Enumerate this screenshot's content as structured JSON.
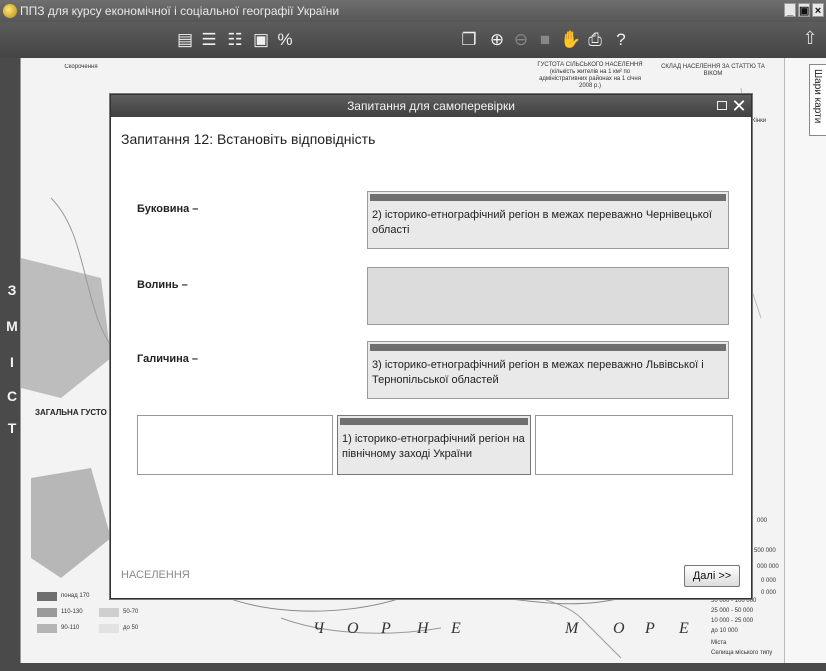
{
  "window": {
    "title": "ППЗ для курсу економічної і соціальної географії України",
    "controls": [
      "_",
      "▣",
      "×"
    ]
  },
  "side_letters": [
    "З",
    "М",
    "І",
    "С",
    "Т"
  ],
  "map": {
    "legend_title": "Скорочення",
    "left_heading": "ЗАГАЛЬНА ГУСТО",
    "right_heading": "ГУСТОТА СІЛЬСЬКОГО НАСЕЛЕННЯ",
    "right_subheading": "(кількість жителів на 1 км² по адміністративних районах на 1 січня 2008 р.)",
    "far_right_heading": "СКЛАД НАСЕЛЕННЯ ЗА СТАТТЮ ТА ВІКОМ",
    "bottom_letters": [
      "Ч",
      "О",
      "Р",
      "Н",
      "Е",
      "М",
      "О",
      "Р",
      "Е"
    ],
    "legend_items": [
      "понад 170",
      "110-130",
      "90-110",
      "50-70",
      "до 50"
    ],
    "right_numbers": [
      "000",
      "2 500 000",
      "000 000",
      "0 000",
      "0 000",
      "50 000 - 100 000",
      "25 000 - 50 000",
      "10 000 - 25 000",
      "до 10 000",
      "Міста",
      "Селища міського типу"
    ],
    "female_label": "Жінки"
  },
  "right_panel": {
    "layers_tab": "Шари карти"
  },
  "dialog": {
    "title": "Запитання для самоперевірки",
    "question": "Запитання 12: Встановіть відповідність",
    "rows": [
      {
        "label": "Буковина –",
        "answer": "2) історико-етнографічний регіон в межах переважно Чернівецької області"
      },
      {
        "label": "Волинь –",
        "answer": ""
      },
      {
        "label": "Галичина –",
        "answer": "3) історико-етнографічний регіон в межах переважно Львівської і Тернопільської областей"
      }
    ],
    "pool_cards": [
      "",
      "1) історико-етнографічний регіон на північному заході України",
      ""
    ],
    "section": "НАСЕЛЕННЯ",
    "next_label": "Далі >>"
  }
}
